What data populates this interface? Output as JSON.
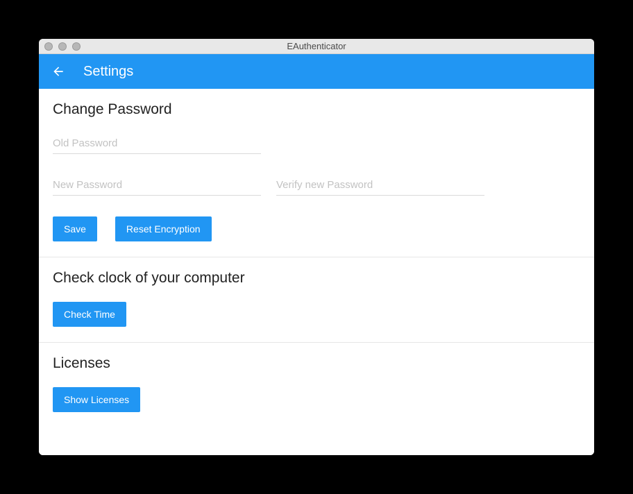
{
  "window": {
    "title": "EAuthenticator"
  },
  "header": {
    "title": "Settings"
  },
  "password_section": {
    "title": "Change Password",
    "old_password_placeholder": "Old Password",
    "old_password_value": "",
    "new_password_placeholder": "New Password",
    "new_password_value": "",
    "verify_password_placeholder": "Verify new Password",
    "verify_password_value": "",
    "save_label": "Save",
    "reset_encryption_label": "Reset Encryption"
  },
  "clock_section": {
    "title": "Check clock of your computer",
    "check_time_label": "Check Time"
  },
  "licenses_section": {
    "title": "Licenses",
    "show_licenses_label": "Show Licenses"
  },
  "colors": {
    "primary": "#2196f3"
  }
}
